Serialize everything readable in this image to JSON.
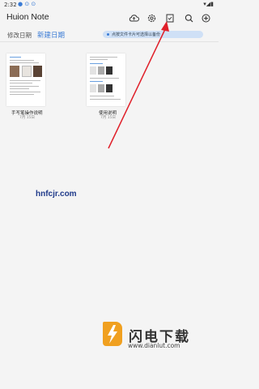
{
  "status_bar": {
    "time": "2:32",
    "notif_icons": "● ⊙ ⊙",
    "right_icons": "▾◢▮"
  },
  "app": {
    "title": "Huion Note"
  },
  "toolbar": {
    "cloud_icon": "cloud-icon",
    "settings_icon": "gear-icon",
    "select_icon": "select-icon",
    "search_icon": "search-icon",
    "add_icon": "plus-icon"
  },
  "sub_bar": {
    "sort_label": "修改日期",
    "new_diary": "新建日期",
    "hint": "点按文件卡片可选择以备份"
  },
  "notes": [
    {
      "title": "手写笔操作说明",
      "date": "7月 15日"
    },
    {
      "title": "使用说明",
      "date": "7月 15日"
    }
  ],
  "watermark": "hnfcjr.com",
  "brand": {
    "name": "闪电下载",
    "url": "www.dianlut.com"
  },
  "colors": {
    "accent": "#3a7bd5",
    "arrow": "#e0202a",
    "brand_orange": "#f0a020"
  }
}
